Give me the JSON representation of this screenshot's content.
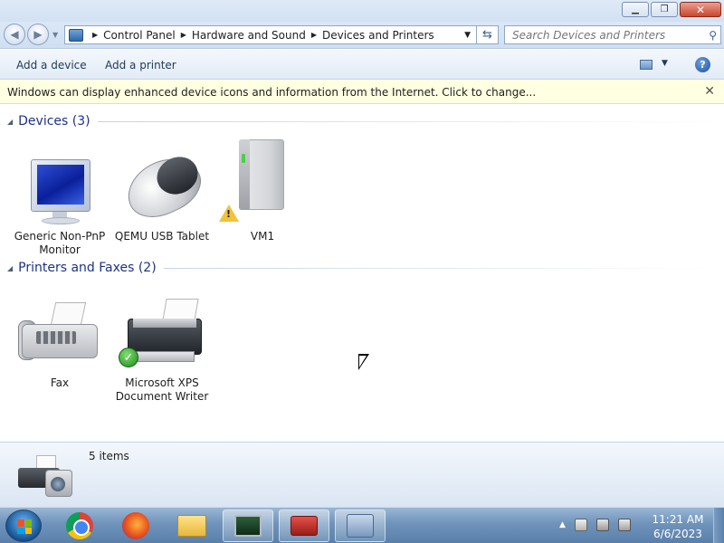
{
  "window": {
    "minimize_icon": "minimize-icon",
    "restore_icon": "restore-icon",
    "close_icon": "close-icon"
  },
  "address_bar": {
    "crumbs": [
      "Control Panel",
      "Hardware and Sound",
      "Devices and Printers"
    ]
  },
  "search": {
    "placeholder": "Search Devices and Printers"
  },
  "toolbar": {
    "add_device": "Add a device",
    "add_printer": "Add a printer"
  },
  "infobar": {
    "message": "Windows can display enhanced device icons and information from the Internet. Click to change..."
  },
  "groups": {
    "devices": {
      "title": "Devices (3)",
      "items": [
        {
          "label": "Generic Non-PnP Monitor",
          "icon": "monitor-icon"
        },
        {
          "label": "QEMU USB Tablet",
          "icon": "mouse-icon"
        },
        {
          "label": "VM1",
          "icon": "computer-icon",
          "status": "warning"
        }
      ]
    },
    "printers": {
      "title": "Printers and Faxes (2)",
      "items": [
        {
          "label": "Fax",
          "icon": "fax-icon"
        },
        {
          "label": "Microsoft XPS Document Writer",
          "icon": "printer-icon",
          "status": "default"
        }
      ]
    }
  },
  "details": {
    "count": "5 items"
  },
  "taskbar": {
    "pinned": [
      "start-button",
      "chrome-icon",
      "firefox-icon",
      "explorer-icon",
      "performance-monitor-icon",
      "toolbox-icon",
      "devices-printers-icon"
    ],
    "active": "devices-printers-icon"
  },
  "clock": {
    "time": "11:21 AM",
    "date": "6/6/2023"
  },
  "colors": {
    "link_blue": "#1e3287",
    "infobar_bg": "#ffffe1",
    "taskbar": "#6f93bb"
  }
}
